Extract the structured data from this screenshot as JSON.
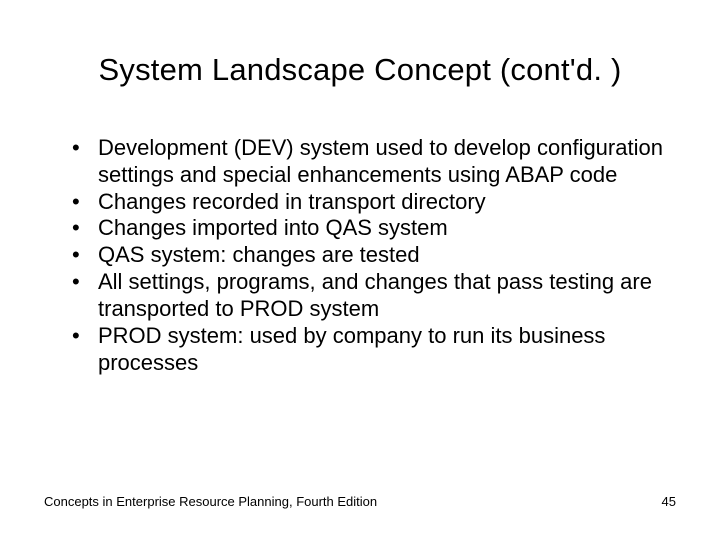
{
  "slide": {
    "title": "System Landscape Concept (cont'd. )",
    "bullets": [
      "Development (DEV) system used to develop configuration settings and special enhancements using ABAP code",
      "Changes recorded in transport directory",
      "Changes imported into QAS system",
      "QAS system: changes are tested",
      "All settings, programs, and changes that pass testing are transported to PROD system",
      "PROD system: used by company to run its business processes"
    ],
    "footer": {
      "left": "Concepts in Enterprise Resource Planning, Fourth Edition",
      "right": "45"
    }
  }
}
